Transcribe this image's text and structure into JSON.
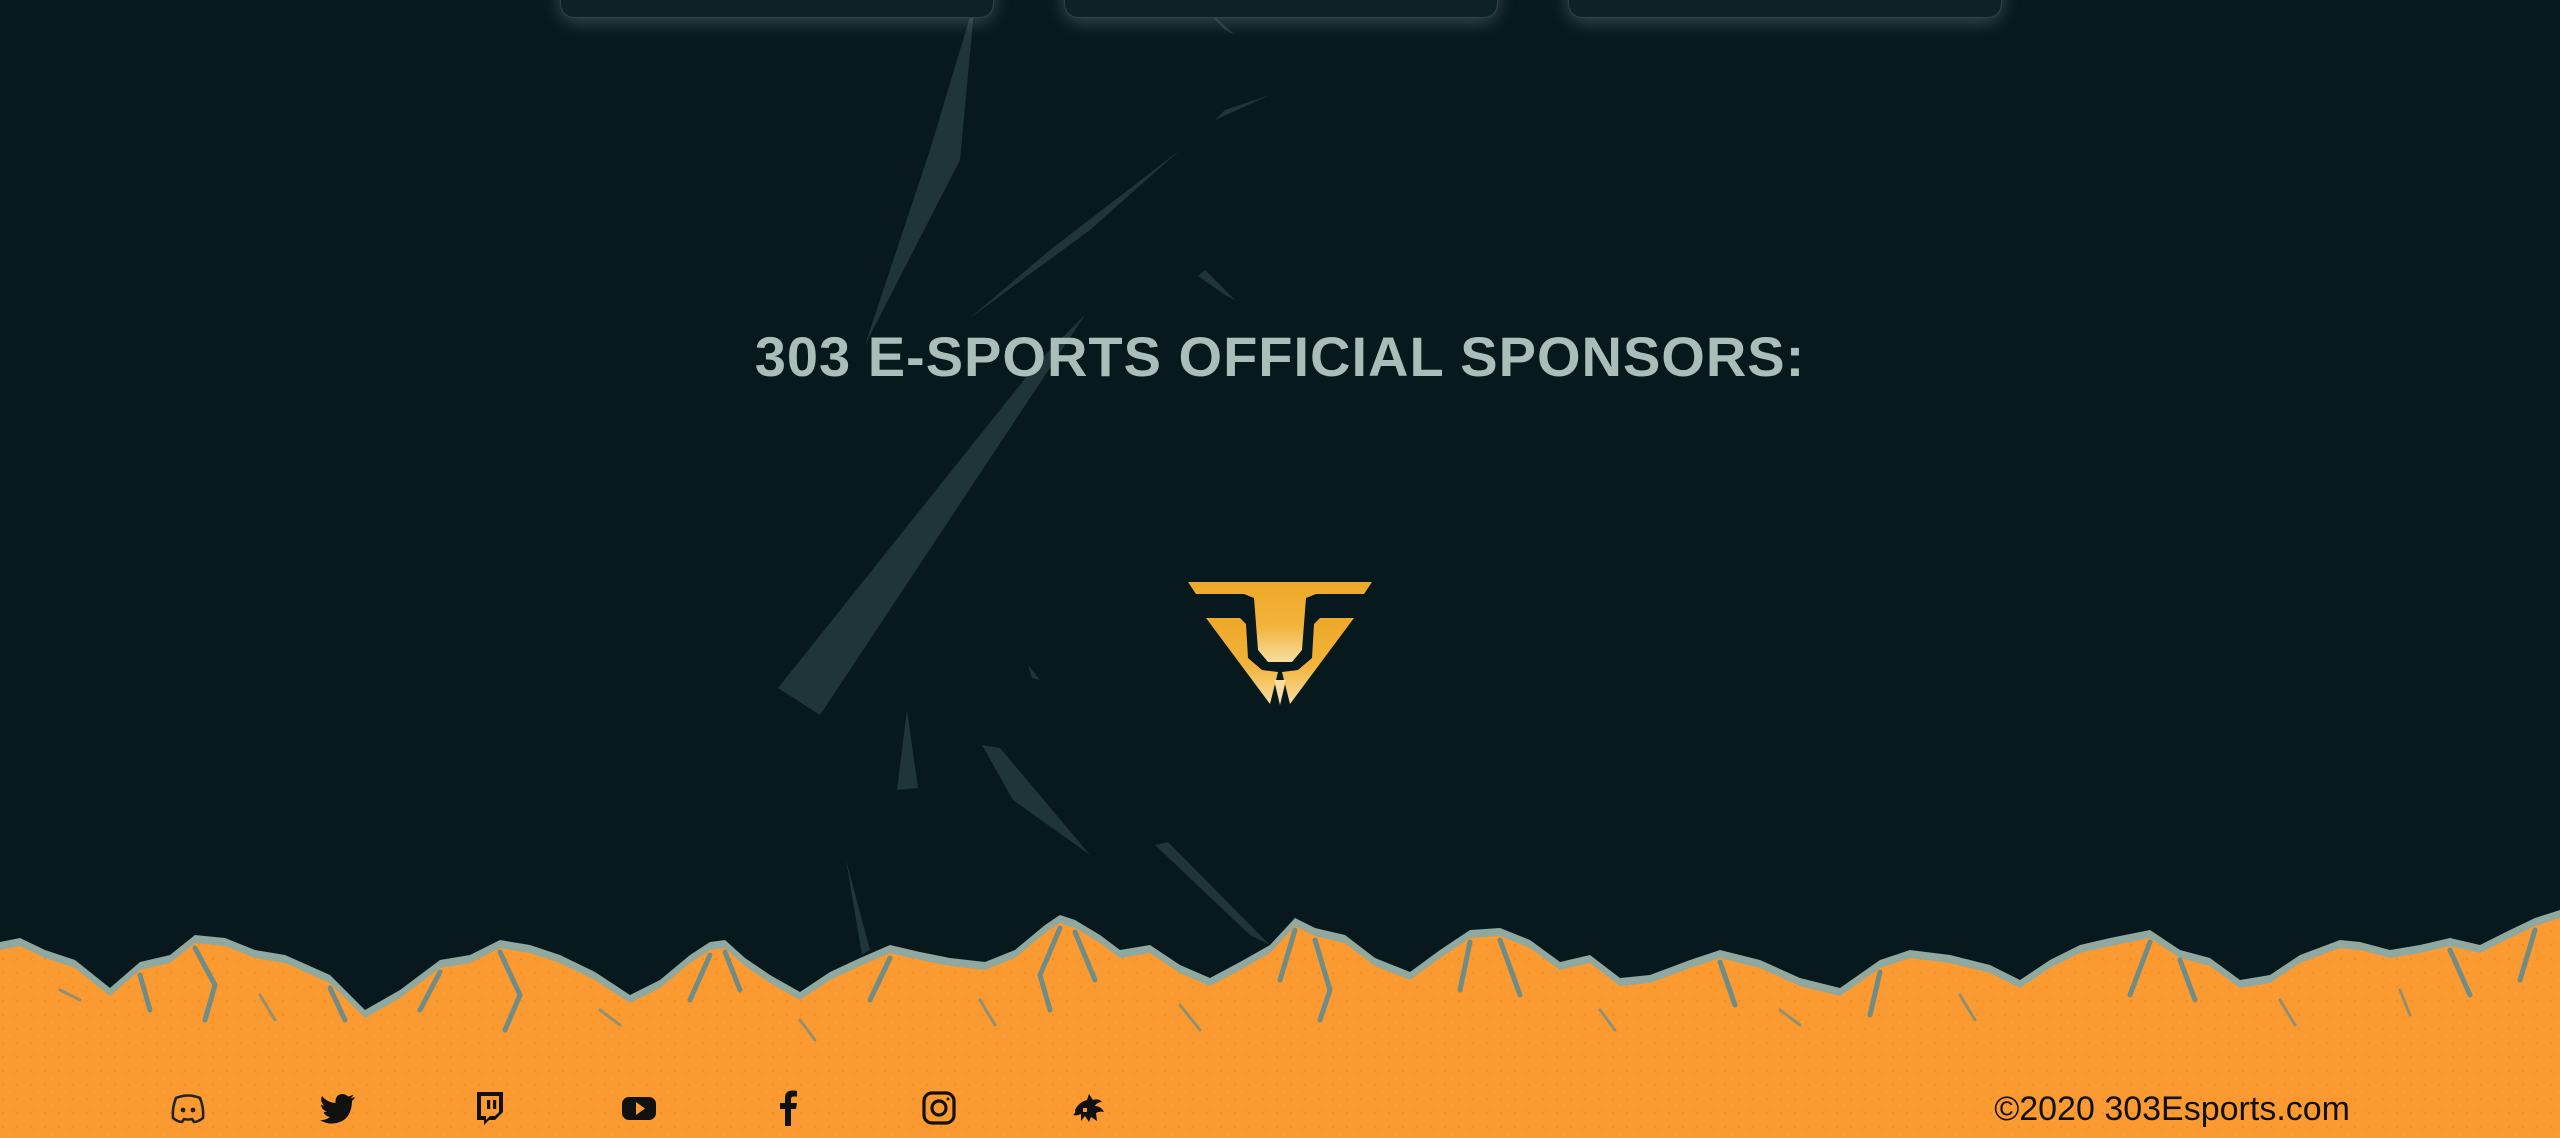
{
  "sponsors": {
    "title": "303 E-SPORTS OFFICIAL SPONSORS:",
    "logo_icon": "triangle-t-sponsor-logo",
    "logo_color": "#f0a928"
  },
  "footer": {
    "social_icons": [
      "discord-icon",
      "twitter-icon",
      "twitch-icon",
      "youtube-icon",
      "facebook-icon",
      "instagram-icon",
      "rumble-icon"
    ],
    "copyright": "©2020 303Esports.com",
    "mountain_color": "#fb9a30",
    "snow_color": "#8fa8a0"
  },
  "colors": {
    "background": "#08191d",
    "title_text": "#a9bdb9",
    "shard": "#23393b"
  }
}
